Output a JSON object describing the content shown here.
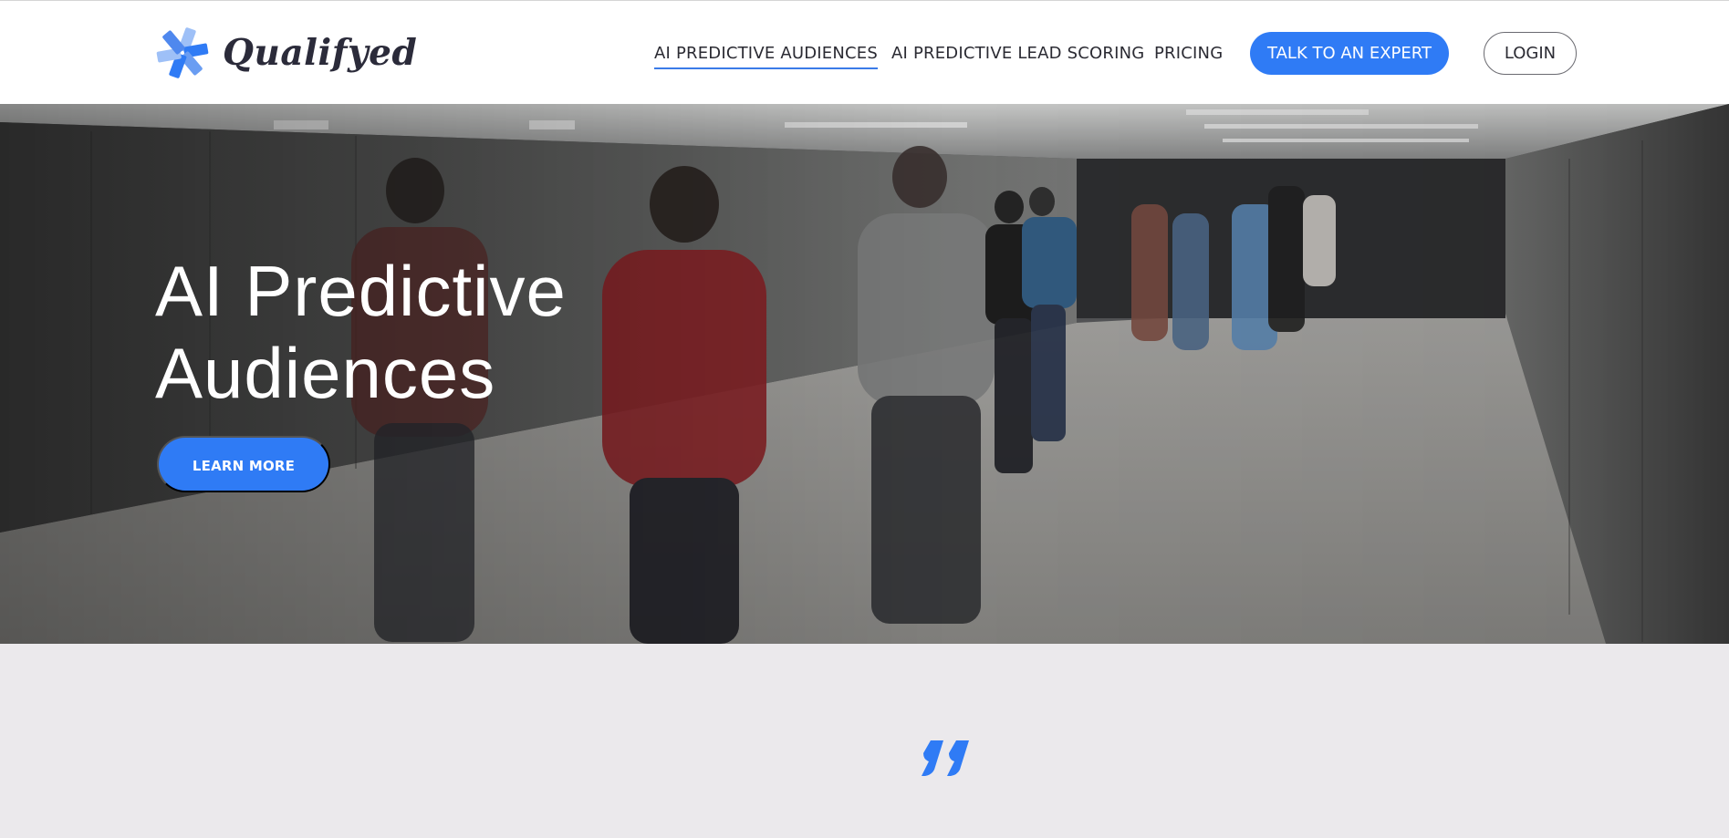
{
  "brand": {
    "name": "Qualifyed",
    "logo_icon": "asterisk-logo-icon",
    "accent_color": "#2f7bf5"
  },
  "nav": {
    "items": [
      {
        "label": "AI PREDICTIVE AUDIENCES",
        "active": true
      },
      {
        "label": "AI PREDICTIVE LEAD SCORING",
        "active": false
      },
      {
        "label": "PRICING",
        "active": false
      }
    ],
    "cta_label": "TALK TO AN EXPERT",
    "login_label": "LOGIN"
  },
  "hero": {
    "title_line1": "AI Predictive",
    "title_line2": "Audiences",
    "button_label": "LEARN MORE",
    "background": "people walking in underground passage photo"
  },
  "testimonial": {
    "quote_icon": "quote-icon"
  }
}
